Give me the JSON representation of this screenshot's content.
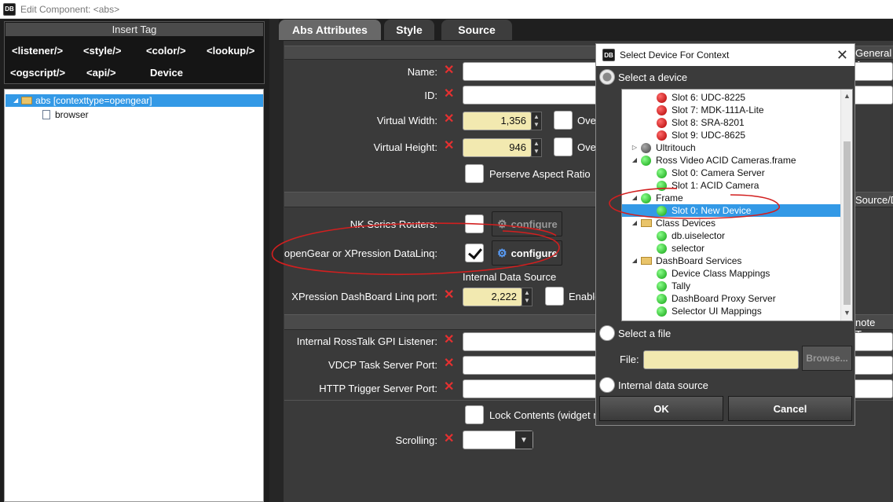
{
  "window": {
    "title": "Edit Component: <abs>"
  },
  "insert_tag": {
    "header": "Insert Tag",
    "tags": [
      "<listener/>",
      "<style/>",
      "<color/>",
      "<lookup/>",
      "<ogscript/>",
      "<api/>",
      "Device"
    ]
  },
  "tree": {
    "root": "abs [contexttype=opengear]",
    "child": "browser"
  },
  "tabs": [
    "Abs Attributes",
    "Style",
    "Source"
  ],
  "form": {
    "name_label": "Name:",
    "id_label": "ID:",
    "vwidth_label": "Virtual Width:",
    "vwidth_value": "1,356",
    "vheight_label": "Virtual Height:",
    "vheight_value": "946",
    "over_label": "Ove",
    "over2_label": "Ove",
    "perserve_label": "Perserve Aspect Ratio",
    "nk_label": "NK Series Routers:",
    "configure_label": "configure",
    "configure2_label": "configure",
    "dataling_label": "openGear or XPression DataLinq:",
    "internal_ds_label": "Internal Data Source",
    "xp_port_label": "XPression DashBoard Linq port:",
    "xp_port_value": "2,222",
    "enable_label": "Enable",
    "rosstalk_label": "Internal RossTalk GPI Listener:",
    "vdcp_label": "VDCP Task Server Port:",
    "http_label": "HTTP Trigger Server Port:",
    "lock_label": "Lock Contents (widget n",
    "scrolling_label": "Scrolling:",
    "section_right1": "General A",
    "section_right2": "Source/D",
    "section_right3": "note Tas"
  },
  "dialog": {
    "title": "Select Device For Context",
    "close": "✕",
    "select_device_label": "Select a device",
    "select_file_label": "Select a file",
    "file_label": "File:",
    "browse_label": "Browse...",
    "internal_label": "Internal data source",
    "ok_label": "OK",
    "cancel_label": "Cancel",
    "devices": [
      {
        "text": "Slot 6: UDC-8225",
        "indent": 2,
        "icon": "red"
      },
      {
        "text": "Slot 7: MDK-111A-Lite",
        "indent": 2,
        "icon": "red"
      },
      {
        "text": "Slot 8: SRA-8201",
        "indent": 2,
        "icon": "red"
      },
      {
        "text": "Slot 9: UDC-8625",
        "indent": 2,
        "icon": "red"
      },
      {
        "text": "Ultritouch",
        "indent": 1,
        "icon": "grey",
        "toggle": "▷"
      },
      {
        "text": "Ross Video ACID Cameras.frame",
        "indent": 1,
        "icon": "green",
        "toggle": "◢"
      },
      {
        "text": "Slot 0: Camera Server",
        "indent": 2,
        "icon": "green"
      },
      {
        "text": "Slot 1: ACID Camera",
        "indent": 2,
        "icon": "green"
      },
      {
        "text": "Frame",
        "indent": 1,
        "icon": "green",
        "toggle": "◢"
      },
      {
        "text": "Slot 0: New Device",
        "indent": 2,
        "icon": "green",
        "selected": true
      },
      {
        "text": "Class Devices",
        "indent": 1,
        "icon": "folder",
        "toggle": "◢"
      },
      {
        "text": "db.uiselector",
        "indent": 2,
        "icon": "green"
      },
      {
        "text": "selector",
        "indent": 2,
        "icon": "green"
      },
      {
        "text": "DashBoard Services",
        "indent": 1,
        "icon": "folder",
        "toggle": "◢"
      },
      {
        "text": "Device Class Mappings",
        "indent": 2,
        "icon": "green"
      },
      {
        "text": "Tally",
        "indent": 2,
        "icon": "green"
      },
      {
        "text": "DashBoard Proxy Server",
        "indent": 2,
        "icon": "green"
      },
      {
        "text": "Selector UI Mappings",
        "indent": 2,
        "icon": "green"
      }
    ]
  },
  "colors": {
    "annotation": "#d21f1f",
    "selection": "#3399e6",
    "numeric_field": "#f2e9b0"
  }
}
